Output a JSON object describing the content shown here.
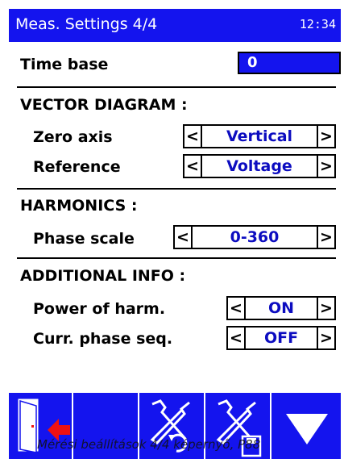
{
  "header": {
    "title": "Meas. Settings 4/4",
    "clock": "12:34"
  },
  "time_base": {
    "label": "Time base",
    "value": "0"
  },
  "vector_diagram": {
    "heading": "VECTOR DIAGRAM :",
    "zero_axis": {
      "label": "Zero axis",
      "value": "Vertical"
    },
    "reference": {
      "label": "Reference",
      "value": "Voltage"
    }
  },
  "harmonics": {
    "heading": "HARMONICS :",
    "phase_scale": {
      "label": "Phase scale",
      "value": "0-360"
    }
  },
  "additional_info": {
    "heading": "ADDITIONAL INFO :",
    "power_of_harm": {
      "label": "Power of harm.",
      "value": "ON"
    },
    "curr_phase_seq": {
      "label": "Curr. phase seq.",
      "value": "OFF"
    }
  },
  "arrows": {
    "left": "<",
    "right": ">"
  },
  "toolbar": {
    "buttons": [
      {
        "icon": "exit-door-icon"
      },
      {
        "icon": "blank"
      },
      {
        "icon": "tools-undo-icon"
      },
      {
        "icon": "tools-save-icon"
      },
      {
        "icon": "arrow-down-icon"
      }
    ]
  },
  "caption": "Mérési beállítások 4/4 képernyő, P88",
  "colors": {
    "accent": "#1414ee",
    "value_text": "#0c0cc0",
    "exit_arrow": "#ee1111"
  }
}
